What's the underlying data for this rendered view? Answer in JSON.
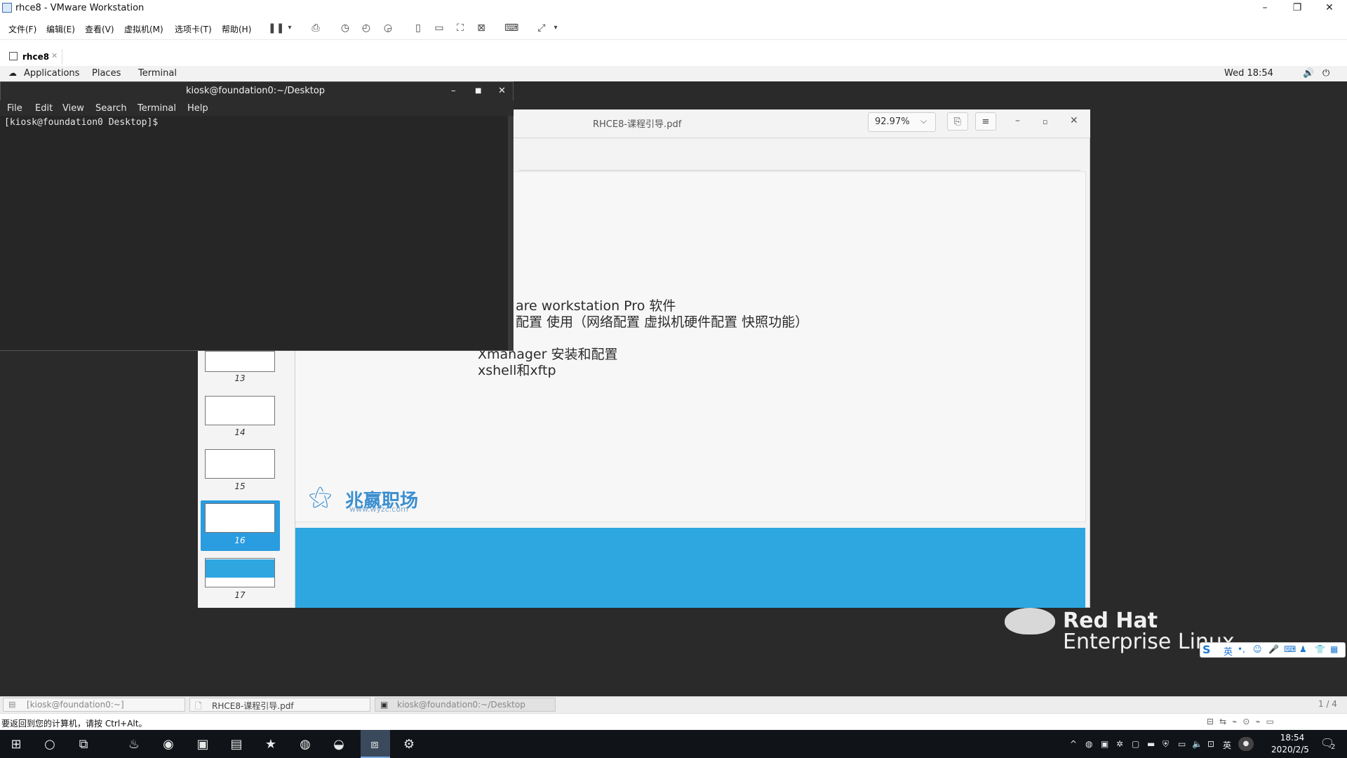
{
  "vmware": {
    "title": "rhce8 - VMware Workstation",
    "menus": [
      "文件(F)",
      "编辑(E)",
      "查看(V)",
      "虚拟机(M)",
      "选项卡(T)",
      "帮助(H)"
    ],
    "tab_label": "rhce8",
    "status_text": "要返回到您的计算机，请按 Ctrl+Alt。"
  },
  "gnome": {
    "applications": "Applications",
    "places": "Places",
    "terminal": "Terminal",
    "clock": "Wed 18:54"
  },
  "terminal": {
    "title": "kiosk@foundation0:~/Desktop",
    "menus": [
      "File",
      "Edit",
      "View",
      "Search",
      "Terminal",
      "Help"
    ],
    "prompt": "[kiosk@foundation0 Desktop]$"
  },
  "pdf": {
    "title": "RHCE8-课程引导.pdf",
    "zoom": "92.97%",
    "lines": [
      "are workstation Pro 软件",
      "配置 使用（网络配置 虚拟机硬件配置 快照功能）",
      "Xmanager 安装和配置",
      "xshell和xftp"
    ],
    "logo_text": "兆嬴职场",
    "logo_url": "www.wyzc.com",
    "thumbnails": [
      {
        "label": "13"
      },
      {
        "label": "14"
      },
      {
        "label": "15"
      },
      {
        "label": "16"
      },
      {
        "label": "17"
      }
    ]
  },
  "desktop": {
    "brand_line1": "Red Hat",
    "brand_line2": "Enterprise Linux"
  },
  "winlist": {
    "item1": "[kiosk@foundation0:~]",
    "item2": "RHCE8-课程引导.pdf",
    "item3": "kiosk@foundation0:~/Desktop",
    "workspace": "1 / 4"
  },
  "ime": {
    "logo": "S",
    "lang": "英"
  },
  "taskbar": {
    "tray_lang": "英",
    "time": "18:54",
    "date": "2020/2/5",
    "badge": "2"
  }
}
